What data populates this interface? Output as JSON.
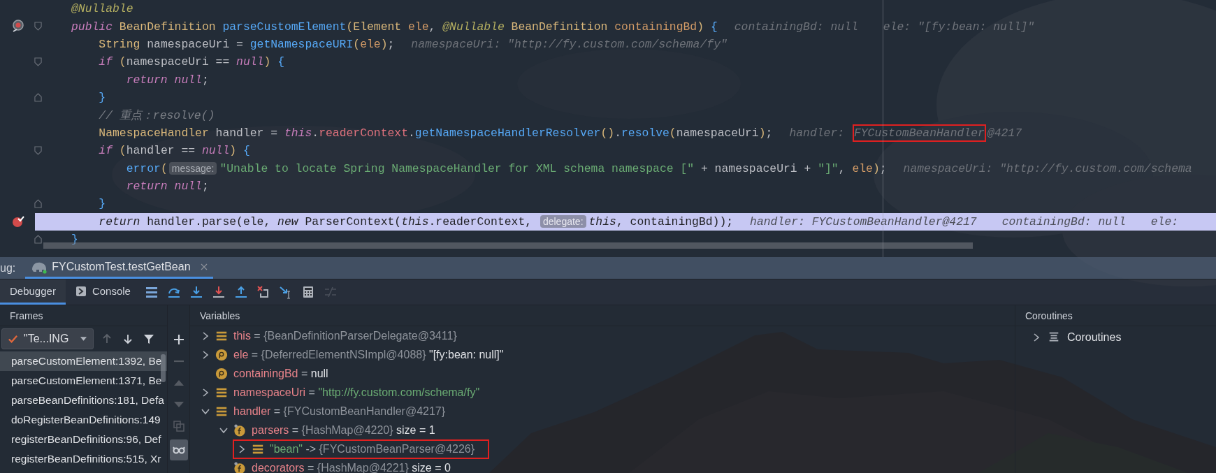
{
  "editor": {
    "lines": [
      {
        "tokens": [
          {
            "t": "@Nullable",
            "kind": "annotation"
          }
        ],
        "highlighted": false
      },
      {
        "tokens": [
          {
            "t": "public ",
            "kind": "keyword"
          },
          {
            "t": "BeanDefinition ",
            "kind": "type"
          },
          {
            "t": "parseCustomElement",
            "kind": "method"
          },
          {
            "t": "(",
            "kind": "paren"
          },
          {
            "t": "Element ",
            "kind": "type"
          },
          {
            "t": "ele",
            "kind": "param"
          },
          {
            "t": ", ",
            "kind": "plain"
          },
          {
            "t": "@Nullable ",
            "kind": "annotation"
          },
          {
            "t": "BeanDefinition ",
            "kind": "type"
          },
          {
            "t": "containingBd",
            "kind": "param"
          },
          {
            "t": ") ",
            "kind": "paren"
          },
          {
            "t": "{",
            "kind": "brace"
          }
        ],
        "hints": [
          {
            "parts": [
              {
                "t": "containingBd: null",
                "boxed": false
              }
            ]
          },
          {
            "parts": [
              {
                "t": "ele: \"[fy:bean: null]\"",
                "boxed": false
              }
            ]
          }
        ],
        "gutter": [
          {
            "kind": "method-breakpoint"
          },
          {
            "kind": "fold-start"
          }
        ],
        "highlighted": false
      },
      {
        "tokens": [
          {
            "t": "    String ",
            "kind": "type"
          },
          {
            "t": "namespaceUri = ",
            "kind": "plain"
          },
          {
            "t": "getNamespaceURI",
            "kind": "method"
          },
          {
            "t": "(",
            "kind": "paren"
          },
          {
            "t": "ele",
            "kind": "param"
          },
          {
            "t": ")",
            "kind": "paren"
          },
          {
            "t": ";",
            "kind": "plain"
          }
        ],
        "hints": [
          {
            "parts": [
              {
                "t": "namespaceUri: \"http://fy.custom.com/schema/fy\"",
                "boxed": false
              }
            ]
          }
        ],
        "highlighted": false
      },
      {
        "tokens": [
          {
            "t": "    if ",
            "kind": "keyword"
          },
          {
            "t": "(",
            "kind": "paren"
          },
          {
            "t": "namespaceUri == ",
            "kind": "plain"
          },
          {
            "t": "null",
            "kind": "keyword"
          },
          {
            "t": ") ",
            "kind": "paren"
          },
          {
            "t": "{",
            "kind": "brace"
          }
        ],
        "gutter": [
          {
            "kind": "fold-start"
          }
        ],
        "highlighted": false
      },
      {
        "tokens": [
          {
            "t": "        return null",
            "kind": "keyword"
          },
          {
            "t": ";",
            "kind": "plain"
          }
        ],
        "highlighted": false
      },
      {
        "tokens": [
          {
            "t": "    }",
            "kind": "brace"
          }
        ],
        "gutter": [
          {
            "kind": "fold-end"
          }
        ],
        "highlighted": false
      },
      {
        "tokens": [
          {
            "t": "    // 重点：resolve()",
            "kind": "comment"
          }
        ],
        "highlighted": false
      },
      {
        "tokens": [
          {
            "t": "    NamespaceHandler ",
            "kind": "type"
          },
          {
            "t": "handler = ",
            "kind": "plain"
          },
          {
            "t": "this",
            "kind": "keyword"
          },
          {
            "t": ".",
            "kind": "plain"
          },
          {
            "t": "readerContext",
            "kind": "field"
          },
          {
            "t": ".",
            "kind": "plain"
          },
          {
            "t": "getNamespaceHandlerResolver",
            "kind": "method"
          },
          {
            "t": "()",
            "kind": "paren"
          },
          {
            "t": ".",
            "kind": "plain"
          },
          {
            "t": "resolve",
            "kind": "method"
          },
          {
            "t": "(",
            "kind": "paren"
          },
          {
            "t": "namespaceUri",
            "kind": "plain"
          },
          {
            "t": ")",
            "kind": "paren"
          },
          {
            "t": ";",
            "kind": "plain"
          }
        ],
        "hints": [
          {
            "parts": [
              {
                "t": "handler: ",
                "boxed": false
              },
              {
                "t": "FYCustomBeanHandler",
                "boxed": true
              },
              {
                "t": "@4217",
                "boxed": false
              }
            ]
          }
        ],
        "highlighted": false
      },
      {
        "tokens": [
          {
            "t": "    if ",
            "kind": "keyword"
          },
          {
            "t": "(",
            "kind": "paren"
          },
          {
            "t": "handler == ",
            "kind": "plain"
          },
          {
            "t": "null",
            "kind": "keyword"
          },
          {
            "t": ") ",
            "kind": "paren"
          },
          {
            "t": "{",
            "kind": "brace"
          }
        ],
        "gutter": [
          {
            "kind": "fold-start"
          }
        ],
        "highlighted": false
      },
      {
        "tokens": [
          {
            "t": "        error",
            "kind": "method"
          },
          {
            "t": "(",
            "kind": "paren"
          },
          {
            "t": "message:",
            "kind": "chip"
          },
          {
            "t": "\"Unable to locate Spring NamespaceHandler for XML schema namespace [\"",
            "kind": "string"
          },
          {
            "t": " + namespaceUri + ",
            "kind": "plain"
          },
          {
            "t": "\"]\"",
            "kind": "string"
          },
          {
            "t": ", ",
            "kind": "plain"
          },
          {
            "t": "ele",
            "kind": "param"
          },
          {
            "t": ")",
            "kind": "paren"
          },
          {
            "t": ";",
            "kind": "plain"
          }
        ],
        "hints": [
          {
            "parts": [
              {
                "t": "namespaceUri: \"http://fy.custom.com/schema",
                "boxed": false
              }
            ]
          }
        ],
        "highlighted": false
      },
      {
        "tokens": [
          {
            "t": "        return null",
            "kind": "keyword"
          },
          {
            "t": ";",
            "kind": "plain"
          }
        ],
        "highlighted": false
      },
      {
        "tokens": [
          {
            "t": "    }",
            "kind": "brace"
          }
        ],
        "gutter": [
          {
            "kind": "fold-end"
          }
        ],
        "highlighted": false
      },
      {
        "tokens": [
          {
            "t": "    return ",
            "kind": "keyword"
          },
          {
            "t": "handler.parse(ele, ",
            "kind": "plain"
          },
          {
            "t": "new ",
            "kind": "keyword"
          },
          {
            "t": "ParserContext(",
            "kind": "plain"
          },
          {
            "t": "this",
            "kind": "keyword"
          },
          {
            "t": ".readerContext, ",
            "kind": "plain"
          },
          {
            "t": "delegate:",
            "kind": "chip"
          },
          {
            "t": "this",
            "kind": "keyword"
          },
          {
            "t": ", containingBd));",
            "kind": "plain"
          }
        ],
        "hints": [
          {
            "parts": [
              {
                "t": "handler: FYCustomBeanHandler@4217",
                "boxed": false
              }
            ]
          },
          {
            "parts": [
              {
                "t": "containingBd: null",
                "boxed": false
              }
            ]
          },
          {
            "parts": [
              {
                "t": "ele:",
                "boxed": false
              }
            ]
          }
        ],
        "gutter": [
          {
            "kind": "breakpoint"
          }
        ],
        "highlighted": true
      },
      {
        "tokens": [
          {
            "t": "}",
            "kind": "brace"
          }
        ],
        "gutter": [
          {
            "kind": "fold-end"
          }
        ],
        "highlighted": false
      }
    ]
  },
  "debug_tabs": {
    "label": "ug:",
    "tabs": [
      {
        "label": "FYCustomTest.testGetBean",
        "selected": true
      }
    ]
  },
  "toolbar": {
    "tabs": [
      {
        "label": "Debugger",
        "selected": true,
        "kind": "plain"
      },
      {
        "label": "Console",
        "selected": false,
        "kind": "console"
      }
    ],
    "actions": [
      {
        "kind": "layout",
        "disabled": false
      },
      {
        "kind": "step-over",
        "disabled": false
      },
      {
        "kind": "step-into",
        "disabled": false
      },
      {
        "kind": "force-step-into",
        "disabled": false
      },
      {
        "kind": "step-out",
        "disabled": false
      },
      {
        "kind": "drop-frame",
        "disabled": false
      },
      {
        "kind": "run-to-cursor",
        "disabled": false
      },
      {
        "kind": "evaluate",
        "disabled": false
      },
      {
        "kind": "trace",
        "disabled": true
      }
    ]
  },
  "frames": {
    "title": "Frames",
    "thread": "\"Te...ING",
    "nav": [
      {
        "kind": "up",
        "disabled": true
      },
      {
        "kind": "down",
        "disabled": false
      },
      {
        "kind": "filter",
        "disabled": false
      }
    ],
    "items": [
      {
        "label": "parseCustomElement:1392, Be",
        "selected": true
      },
      {
        "label": "parseCustomElement:1371, Be",
        "selected": false
      },
      {
        "label": "parseBeanDefinitions:181, Defa",
        "selected": false
      },
      {
        "label": "doRegisterBeanDefinitions:149",
        "selected": false
      },
      {
        "label": "registerBeanDefinitions:96, Def",
        "selected": false
      },
      {
        "label": "registerBeanDefinitions:515, Xr",
        "selected": false
      }
    ]
  },
  "side_toolbar": [
    {
      "kind": "add",
      "disabled": false,
      "selected": false
    },
    {
      "kind": "remove",
      "disabled": true,
      "selected": false
    },
    {
      "kind": "move-up",
      "disabled": true,
      "selected": false
    },
    {
      "kind": "move-down",
      "disabled": true,
      "selected": false
    },
    {
      "kind": "copy",
      "disabled": true,
      "selected": false
    },
    {
      "kind": "watches",
      "disabled": false,
      "selected": true
    }
  ],
  "variables": {
    "title": "Variables",
    "items": [
      {
        "kind": "object",
        "expanded": false,
        "boxed": false,
        "parts": [
          {
            "t": "this",
            "kind": "name"
          },
          {
            "t": " = ",
            "kind": "op"
          },
          {
            "t": "{BeanDefinitionParserDelegate@3411}",
            "kind": "ref"
          }
        ]
      },
      {
        "kind": "parameter",
        "expanded": false,
        "boxed": false,
        "parts": [
          {
            "t": "ele",
            "kind": "name"
          },
          {
            "t": " = ",
            "kind": "op"
          },
          {
            "t": "{DeferredElementNSImpl@4088}",
            "kind": "ref"
          },
          {
            "t": " \"[fy:bean: null]\"",
            "kind": "plain"
          }
        ]
      },
      {
        "kind": "parameter",
        "boxed": false,
        "parts": [
          {
            "t": "containingBd",
            "kind": "name"
          },
          {
            "t": " = ",
            "kind": "op"
          },
          {
            "t": "null",
            "kind": "plain"
          }
        ]
      },
      {
        "kind": "object",
        "expanded": false,
        "boxed": false,
        "parts": [
          {
            "t": "namespaceUri",
            "kind": "name"
          },
          {
            "t": " = ",
            "kind": "op"
          },
          {
            "t": "\"http://fy.custom.com/schema/fy\"",
            "kind": "string"
          }
        ]
      },
      {
        "kind": "object",
        "expanded": true,
        "boxed": false,
        "parts": [
          {
            "t": "handler",
            "kind": "name"
          },
          {
            "t": " = ",
            "kind": "op"
          },
          {
            "t": "{FYCustomBeanHandler@4217}",
            "kind": "ref"
          }
        ],
        "children": [
          {
            "kind": "field",
            "expanded": true,
            "boxed": false,
            "parts": [
              {
                "t": "parsers",
                "kind": "name"
              },
              {
                "t": " = ",
                "kind": "op"
              },
              {
                "t": "{HashMap@4220}",
                "kind": "ref"
              },
              {
                "t": "  size = 1",
                "kind": "plain"
              }
            ],
            "children": [
              {
                "kind": "object",
                "expanded": false,
                "boxed": true,
                "parts": [
                  {
                    "t": "\"bean\"",
                    "kind": "string"
                  },
                  {
                    "t": " -> ",
                    "kind": "op"
                  },
                  {
                    "t": "{FYCustomBeanParser@4226}",
                    "kind": "ref"
                  }
                ]
              }
            ]
          },
          {
            "kind": "field",
            "boxed": false,
            "parts": [
              {
                "t": "decorators",
                "kind": "name"
              },
              {
                "t": " = ",
                "kind": "op"
              },
              {
                "t": "{HashMap@4221}",
                "kind": "ref"
              },
              {
                "t": "  size = 0",
                "kind": "plain"
              }
            ]
          }
        ]
      }
    ]
  },
  "coroutines": {
    "title": "Coroutines",
    "items": [
      {
        "label": "Coroutines",
        "expanded": false
      }
    ]
  }
}
